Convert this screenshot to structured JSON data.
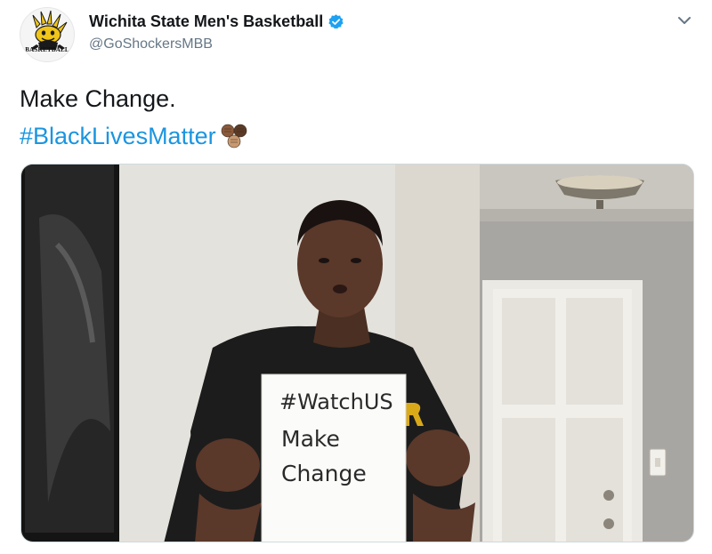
{
  "tweet": {
    "author": {
      "display_name": "Wichita State Men's Basketball",
      "handle": "@GoShockersMBB",
      "verified": true,
      "avatar_text": "BASKETBALL",
      "avatar_icon": "wushock-logo-icon"
    },
    "text_line_1": "Make Change.",
    "text_line_2": "#BlackLivesMatter",
    "hashtag_color": "#1b95e0",
    "emoji": "raised-fists-emoji",
    "menu_icon": "chevron-down-icon",
    "media": {
      "type": "video-still",
      "sign_lines": [
        "#WatchUS",
        "Make",
        "Change"
      ]
    }
  }
}
